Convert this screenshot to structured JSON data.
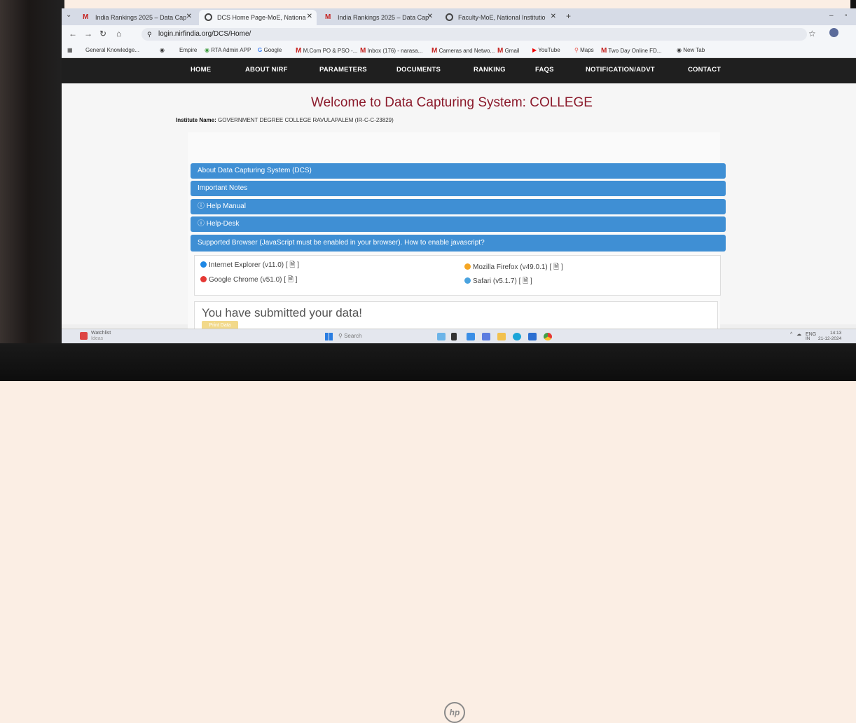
{
  "tabs": [
    {
      "title": "India Rankings 2025 – Data Cap",
      "icon": "gmail-icon"
    },
    {
      "title": "DCS Home Page-MoE, Nationa",
      "icon": "globe-icon",
      "active": true
    },
    {
      "title": "India Rankings 2025 – Data Cap",
      "icon": "gmail-icon"
    },
    {
      "title": "Faculty-MoE, National Institutio",
      "icon": "globe-icon"
    }
  ],
  "address_bar": {
    "url": "login.nirfindia.org/DCS/Home/"
  },
  "bookmarks": [
    "General Knowledge...",
    "Empire",
    "RTA Admin APP",
    "Google",
    "M.Com PO & PSO -...",
    "Inbox (176) - narasa...",
    "Cameras and Netwo...",
    "Gmail",
    "YouTube",
    "Maps",
    "Two Day Online FD...",
    "New Tab"
  ],
  "site_nav": [
    "HOME",
    "ABOUT NIRF",
    "PARAMETERS",
    "DOCUMENTS",
    "RANKING",
    "FAQS",
    "NOTIFICATION/ADVT",
    "CONTACT"
  ],
  "page": {
    "welcome": "Welcome to Data Capturing System: COLLEGE",
    "institute_label": "Institute Name:",
    "institute_value": "GOVERNMENT DEGREE COLLEGE RAVULAPALEM (IR-C-C-23829)",
    "accordion": [
      "About Data Capturing System (DCS)",
      "Important Notes",
      "ⓘ Help Manual",
      "ⓘ Help-Desk",
      "Supported Browser (JavaScript must be enabled in your browser). How to enable javascript?"
    ],
    "browsers": [
      {
        "name": "Internet Explorer (v11.0)  [ 🗎 ]",
        "color": "#1e88e5"
      },
      {
        "name": "Google Chrome (v51.0)  [ 🗎 ]",
        "color": "#e53935"
      },
      {
        "name": "Mozilla Firefox (v49.0.1)  [ 🗎 ]",
        "color": "#f5a623"
      },
      {
        "name": "Safari (v5.1.7)  [ 🗎 ]",
        "color": "#4aa3df"
      }
    ],
    "submitted_message": "You have submitted your data!",
    "print_button": "Print Data"
  },
  "taskbar": {
    "watchlist_title": "Watchlist",
    "watchlist_sub": "Ideas",
    "search_placeholder": "Search",
    "lang": "ENG",
    "region": "IN",
    "time": "14:13",
    "date": "21-12-2024"
  }
}
